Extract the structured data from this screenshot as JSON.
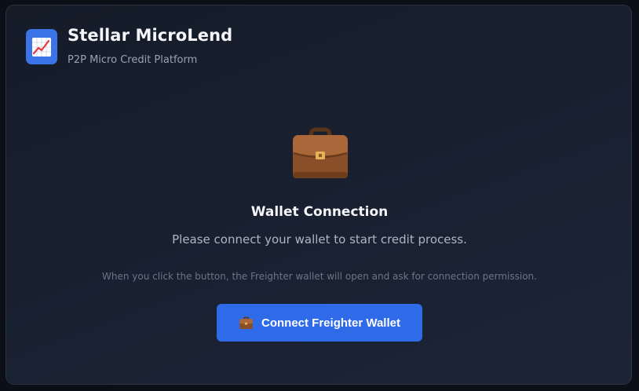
{
  "header": {
    "app_title": "Stellar MicroLend",
    "app_subtitle": "P2P Micro Credit Platform",
    "logo_icon": "chart-increasing-icon"
  },
  "wallet": {
    "icon": "briefcase-icon",
    "title": "Wallet Connection",
    "description": "Please connect your wallet to start credit process.",
    "note": "When you click the button, the Freighter wallet will open and ask for connection permission.",
    "button_label": "Connect Freighter Wallet",
    "button_icon": "briefcase-icon"
  },
  "colors": {
    "accent": "#2f6ae8",
    "logo_bg": "#3b73e8",
    "background": "#0b0f17",
    "card": "#182030"
  }
}
